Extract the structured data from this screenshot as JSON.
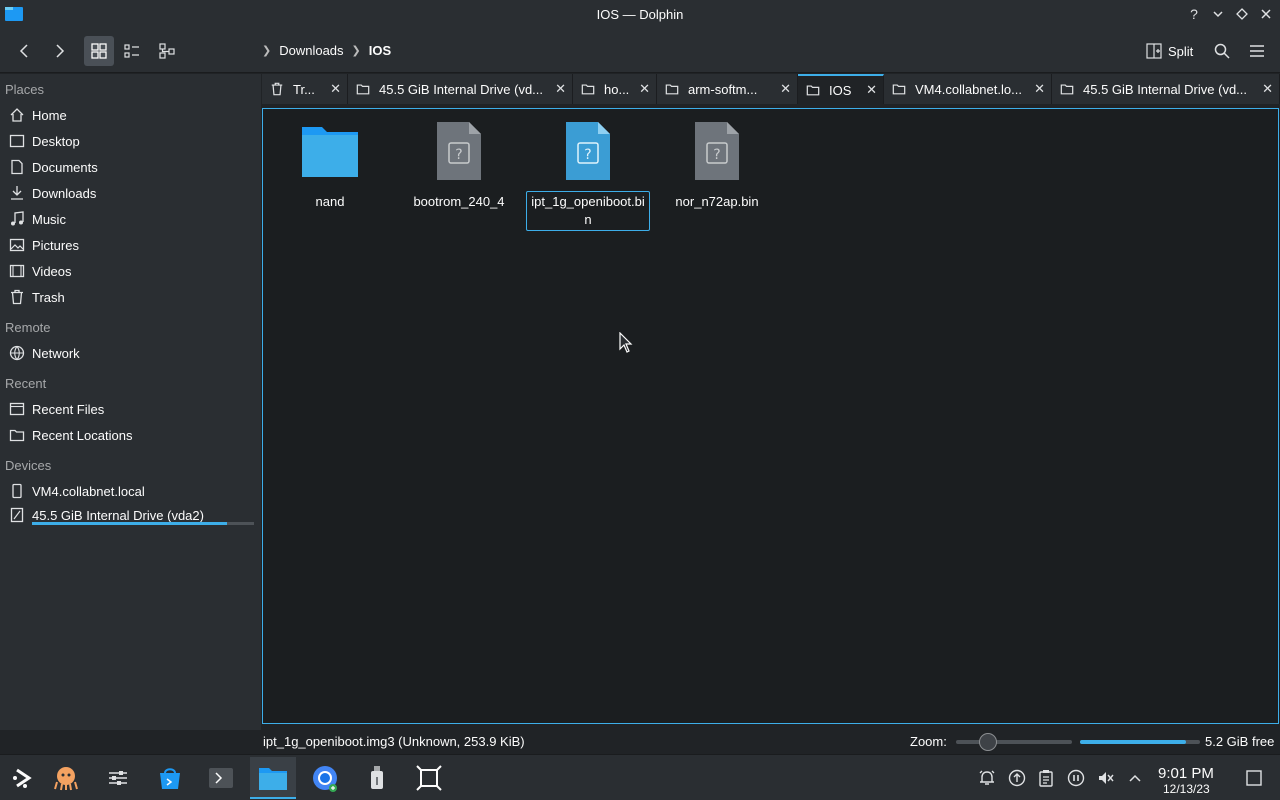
{
  "window": {
    "title": "IOS — Dolphin"
  },
  "toolbar": {
    "breadcrumb": [
      "Downloads",
      "IOS"
    ],
    "split_label": "Split"
  },
  "sidebar": {
    "sections": [
      "Places",
      "Remote",
      "Recent",
      "Devices"
    ],
    "places": [
      "Home",
      "Desktop",
      "Documents",
      "Downloads",
      "Music",
      "Pictures",
      "Videos",
      "Trash"
    ],
    "remote": [
      "Network"
    ],
    "recent": [
      "Recent Files",
      "Recent Locations"
    ],
    "devices": [
      "VM4.collabnet.local",
      "45.5 GiB Internal Drive (vda2)"
    ],
    "drive_usage_fraction": 0.88
  },
  "tabs": [
    "Tr...",
    "45.5 GiB Internal Drive (vd...",
    "ho...",
    "arm-softm...",
    "IOS",
    "VM4.collabnet.lo...",
    "45.5 GiB Internal Drive (vd..."
  ],
  "files": [
    {
      "name": "nand",
      "type": "folder"
    },
    {
      "name": "bootrom_240_4",
      "type": "unknown"
    },
    {
      "name": "ipt_1g_openiboot.bin",
      "type": "unknown"
    },
    {
      "name": "nor_n72ap.bin",
      "type": "unknown"
    }
  ],
  "status": {
    "selection": "ipt_1g_openiboot.img3 (Unknown, 253.9 KiB)",
    "zoom_label": "Zoom:",
    "free_space": "5.2 GiB free",
    "free_usage_fraction": 0.88
  },
  "clock": {
    "time": "9:01 PM",
    "date": "12/13/23"
  },
  "colors": {
    "accent": "#3daee9",
    "background": "#202326",
    "panel": "#2a2e32"
  }
}
